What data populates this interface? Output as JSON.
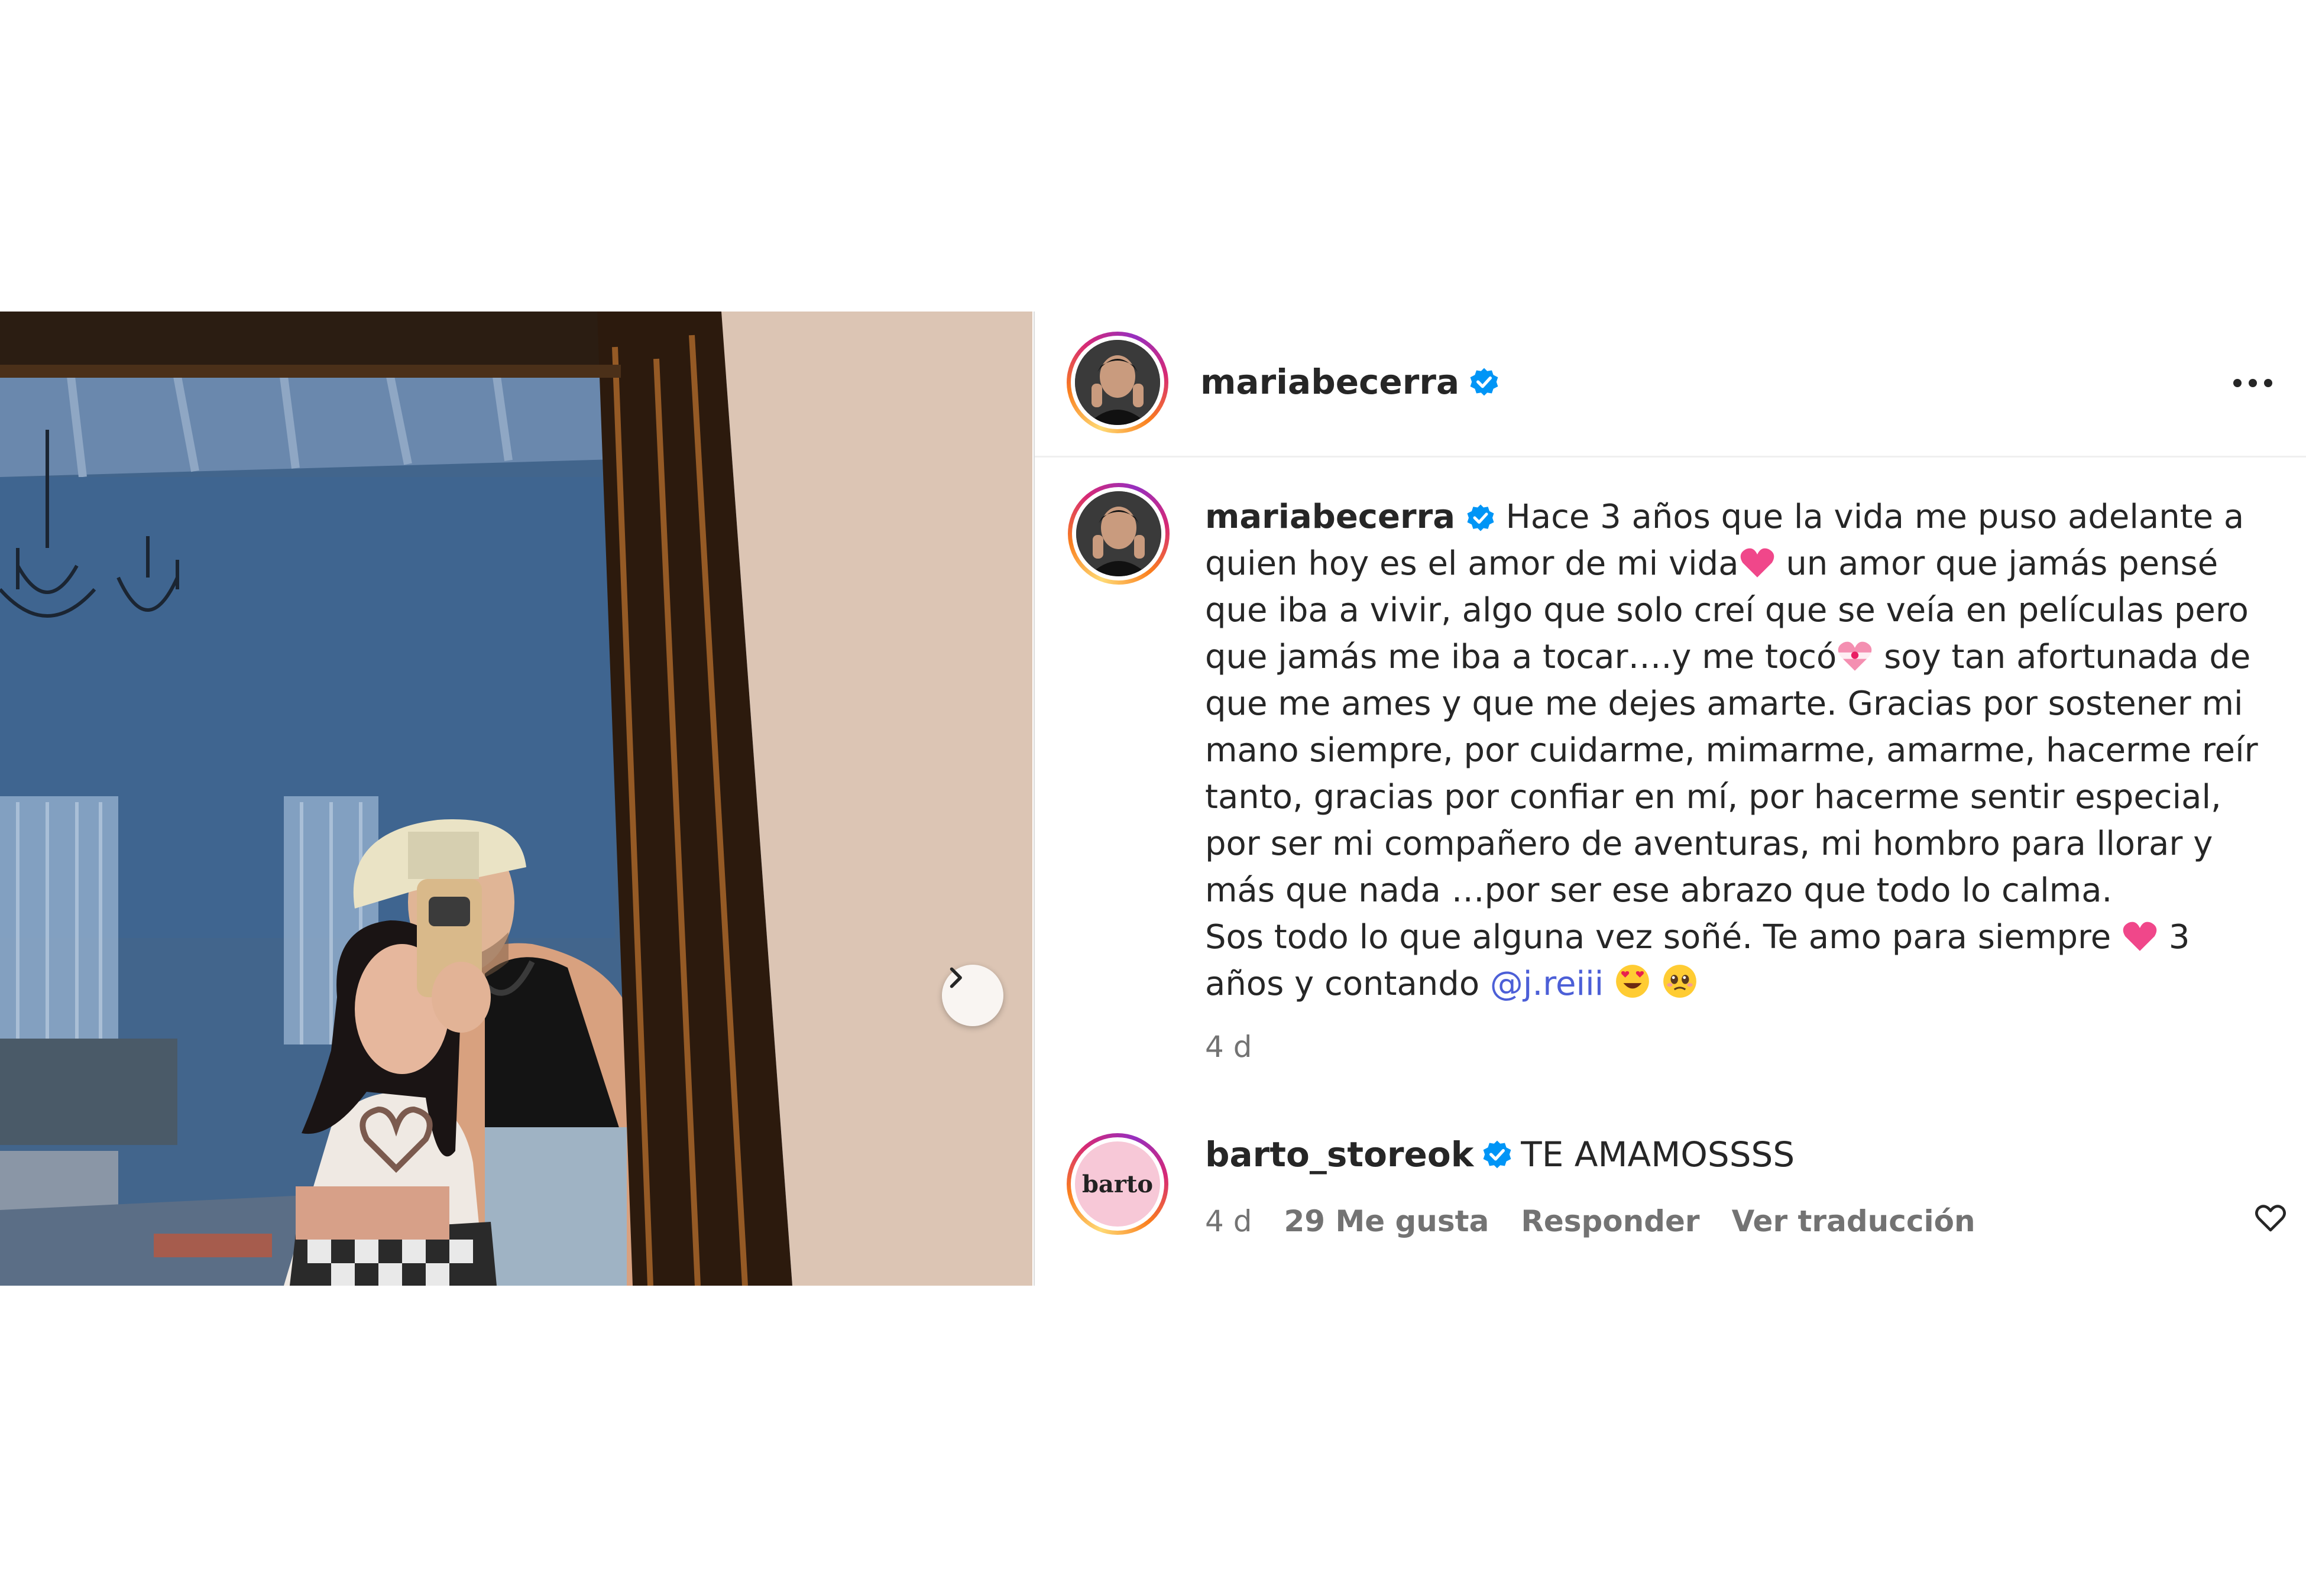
{
  "post": {
    "header": {
      "username": "mariabecerra",
      "avatar_icon": "profile-avatar",
      "verified_icon": "verified-badge-icon",
      "more_icon": "more-options-icon"
    },
    "caption": {
      "username": "mariabecerra",
      "part1": "Hace 3 años que la vida me puso adelante a quien hoy es el amor de mi vida",
      "part2": " un amor que jamás pensé que iba a vivir, algo que solo creí que se veía en películas pero que jamás me iba a tocar….y me tocó",
      "part3": " soy tan afortunada de que me ames y que me dejes amarte. Gracias por sostener mi mano siempre, por cuidarme, mimarme, amarme, hacerme reír tanto, gracias por confiar en mí, por hacerme sentir especial, por ser mi compañero de aventuras, mi hombro para llorar y más que nada …por ser ese abrazo que todo lo calma.",
      "part4": "Sos todo lo que alguna vez soñé. Te amo para siempre",
      "part5": " 3 años y contando ",
      "mention": "@j.reiii",
      "time": "4 d"
    },
    "comment": {
      "username": "barto_storeok",
      "avatar_label": "barto",
      "text": "TE AMAMOSSSS",
      "time": "4 d",
      "likes": "29 Me gusta",
      "reply_label": "Responder",
      "translate_label": "Ver traducción"
    },
    "carousel": {
      "next_icon": "chevron-right-icon"
    },
    "colors": {
      "mention": "#4c5fd7",
      "verified": "#0095f6",
      "secondary_text": "#737373"
    }
  }
}
